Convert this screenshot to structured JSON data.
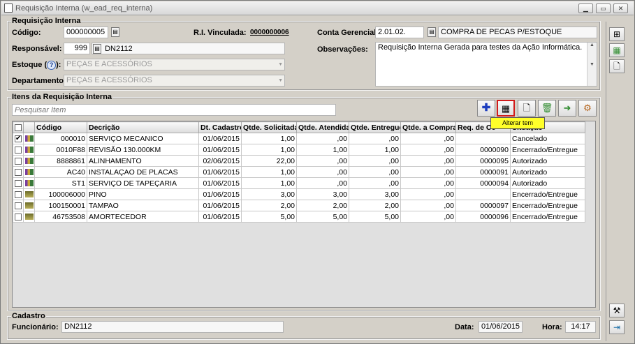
{
  "window": {
    "title": "Requisição Interna (w_ead_req_interna)"
  },
  "header": {
    "group_title": "Requisição Interna",
    "codigo_label": "Código:",
    "codigo_value": "000000005",
    "ri_vinculada_label": "R.I. Vinculada:",
    "ri_vinculada_value": "0000000006",
    "conta_label": "Conta Gerencial:",
    "conta_code": "2.01.02.",
    "conta_desc": "COMPRA DE PECAS P/ESTOQUE",
    "responsavel_label": "Responsável:",
    "responsavel_code": "999",
    "responsavel_name": "DN2112",
    "observacoes_label": "Observações:",
    "observacoes_value": "Requisição Interna Gerada para testes da Ação Informática.",
    "estoque_label": "Estoque (",
    "estoque_label_end": "):",
    "estoque_value": "PEÇAS E ACESSÓRIOS",
    "departamento_label": "Departamento:",
    "departamento_value": "PEÇAS E ACESSÓRIOS"
  },
  "items": {
    "group_title": "Itens da Requisição Interna",
    "search_placeholder": "Pesquisar Item",
    "tooltip": "Alterar tem",
    "columns": [
      "",
      "",
      "Código",
      "Decrição",
      "Dt. Cadastro",
      "Qtde. Solicitada",
      "Qtde. Atendida",
      "Qtde. Entregue",
      "Qtde. a Comprar",
      "Req. de Co",
      "Situação"
    ],
    "rows": [
      {
        "checked": "✔",
        "codigo": "000010",
        "descricao": "SERVIÇO MECANICO",
        "dt": "01/06/2015",
        "sol": "1,00",
        "at": ",00",
        "ent": ",00",
        "comp": ",00",
        "req": "",
        "sit": "Cancelado"
      },
      {
        "checked": "",
        "codigo": "0010F88",
        "descricao": "REVISÃO 130.000KM",
        "dt": "01/06/2015",
        "sol": "1,00",
        "at": "1,00",
        "ent": "1,00",
        "comp": ",00",
        "req": "0000090",
        "sit": "Encerrado/Entregue"
      },
      {
        "checked": "",
        "codigo": "8888861",
        "descricao": "ALINHAMENTO",
        "dt": "02/06/2015",
        "sol": "22,00",
        "at": ",00",
        "ent": ",00",
        "comp": ",00",
        "req": "0000095",
        "sit": "Autorizado"
      },
      {
        "checked": "",
        "codigo": "AC40",
        "descricao": "INSTALAÇAO DE PLACAS",
        "dt": "01/06/2015",
        "sol": "1,00",
        "at": ",00",
        "ent": ",00",
        "comp": ",00",
        "req": "0000091",
        "sit": "Autorizado"
      },
      {
        "checked": "",
        "codigo": "ST1",
        "descricao": "SERVIÇO DE TAPEÇARIA",
        "dt": "01/06/2015",
        "sol": "1,00",
        "at": ",00",
        "ent": ",00",
        "comp": ",00",
        "req": "0000094",
        "sit": "Autorizado"
      },
      {
        "checked": "",
        "codigo": "100006000",
        "descricao": "PINO",
        "dt": "01/06/2015",
        "sol": "3,00",
        "at": "3,00",
        "ent": "3,00",
        "comp": ",00",
        "req": "",
        "sit": "Encerrado/Entregue"
      },
      {
        "checked": "",
        "codigo": "100150001",
        "descricao": "TAMPAO",
        "dt": "01/06/2015",
        "sol": "2,00",
        "at": "2,00",
        "ent": "2,00",
        "comp": ",00",
        "req": "0000097",
        "sit": "Encerrado/Entregue"
      },
      {
        "checked": "",
        "codigo": "46753508",
        "descricao": "AMORTECEDOR",
        "dt": "01/06/2015",
        "sol": "5,00",
        "at": "5,00",
        "ent": "5,00",
        "comp": ",00",
        "req": "0000096",
        "sit": "Encerrado/Entregue"
      }
    ]
  },
  "cadastro": {
    "group_title": "Cadastro",
    "funcionario_label": "Funcionário:",
    "funcionario_value": "DN2112",
    "data_label": "Data:",
    "data_value": "01/06/2015",
    "hora_label": "Hora:",
    "hora_value": "14:17"
  },
  "icons": [
    "add-icon",
    "edit-grid-icon",
    "preview-icon",
    "delete-icon",
    "forward-icon",
    "process-icon",
    "help-icon",
    "lookup-icon",
    "exit-icon"
  ],
  "colors": {
    "window_bg": "#d4d0c8",
    "tooltip_bg": "#ffff2a",
    "highlight_border": "#d11b1b",
    "add_blue": "#1f3fbf",
    "delete_green": "#2e8b2e"
  }
}
